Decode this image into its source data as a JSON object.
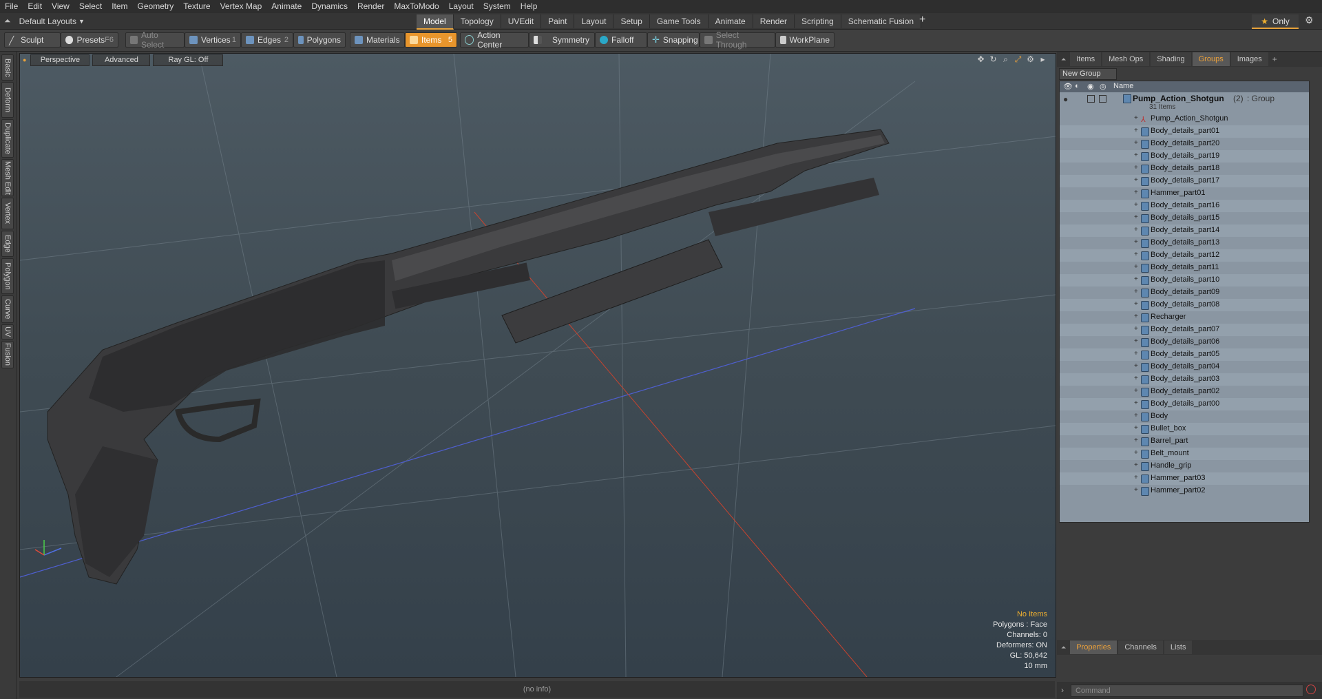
{
  "menu": [
    "File",
    "Edit",
    "View",
    "Select",
    "Item",
    "Geometry",
    "Texture",
    "Vertex Map",
    "Animate",
    "Dynamics",
    "Render",
    "MaxToModo",
    "Layout",
    "System",
    "Help"
  ],
  "layout_selector": "Default Layouts",
  "mode_tabs": [
    "Model",
    "Topology",
    "UVEdit",
    "Paint",
    "Layout",
    "Setup",
    "Game Tools",
    "Animate",
    "Render",
    "Scripting",
    "Schematic Fusion"
  ],
  "only_label": "Only",
  "toolbar": {
    "sculpt": "Sculpt",
    "presets": "Presets",
    "presets_key": "F6",
    "auto_select": "Auto Select",
    "vertices": "Vertices",
    "vertices_key": "1",
    "edges": "Edges",
    "edges_key": "2",
    "polygons": "Polygons",
    "materials": "Materials",
    "items": "Items",
    "items_key": "5",
    "action_center": "Action Center",
    "symmetry": "Symmetry",
    "falloff": "Falloff",
    "snapping": "Snapping",
    "select_through": "Select Through",
    "workplane": "WorkPlane"
  },
  "left_tabs": [
    "Basic",
    "Deform",
    "Duplicate",
    "Mesh Edit",
    "Vertex",
    "Edge",
    "Polygon",
    "Curve",
    "UV",
    "Fusion"
  ],
  "viewport": {
    "perspective": "Perspective",
    "advanced": "Advanced",
    "raygl": "Ray GL: Off",
    "info": {
      "no_items": "No Items",
      "polygons": "Polygons : Face",
      "channels": "Channels: 0",
      "deformers": "Deformers: ON",
      "gl": "GL: 50,642",
      "scale": "10 mm"
    }
  },
  "status": "(no info)",
  "right_panel": {
    "tabs": [
      "Items",
      "Mesh Ops",
      "Shading",
      "Groups",
      "Images"
    ],
    "active_tab": "Groups",
    "new_group": "New Group",
    "name_header": "Name",
    "group_name": "Pump_Action_Shotgun",
    "group_count": "(2)",
    "group_type": ": Group",
    "group_items": "31 Items",
    "items": [
      "Pump_Action_Shotgun",
      "Body_details_part01",
      "Body_details_part20",
      "Body_details_part19",
      "Body_details_part18",
      "Body_details_part17",
      "Hammer_part01",
      "Body_details_part16",
      "Body_details_part15",
      "Body_details_part14",
      "Body_details_part13",
      "Body_details_part12",
      "Body_details_part11",
      "Body_details_part10",
      "Body_details_part09",
      "Body_details_part08",
      "Recharger",
      "Body_details_part07",
      "Body_details_part06",
      "Body_details_part05",
      "Body_details_part04",
      "Body_details_part03",
      "Body_details_part02",
      "Body_details_part00",
      "Body",
      "Bullet_box",
      "Barrel_part",
      "Belt_mount",
      "Handle_grip",
      "Hammer_part03",
      "Hammer_part02"
    ],
    "bottom_tabs": [
      "Properties",
      "Channels",
      "Lists"
    ],
    "command_placeholder": "Command"
  },
  "colors": {
    "accent": "#e8952c",
    "list_bg": "#8a96a2",
    "viewport_bg": "#45525b"
  }
}
